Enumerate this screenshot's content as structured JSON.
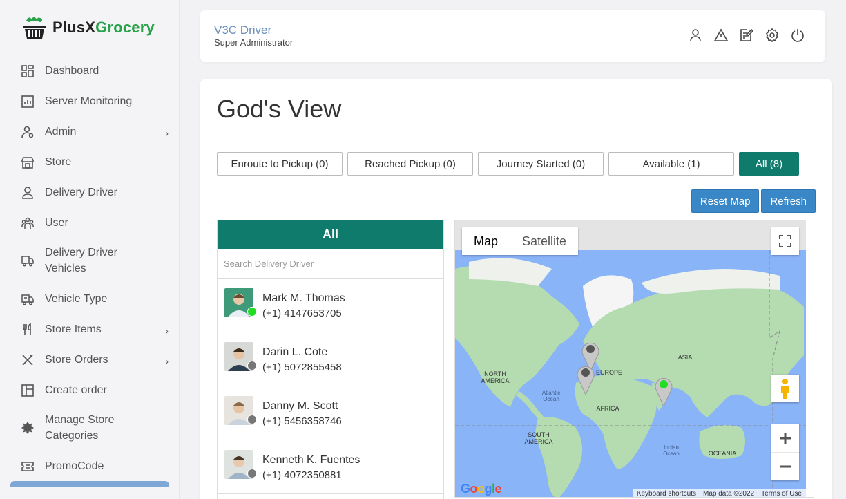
{
  "brand": {
    "name_part1": "PlusX",
    "name_part2": "Grocery"
  },
  "sidebar": {
    "items": [
      {
        "label": "Dashboard",
        "icon": "dashboard-icon"
      },
      {
        "label": "Server Monitoring",
        "icon": "chart-icon"
      },
      {
        "label": "Admin",
        "icon": "admin-user-icon",
        "has_submenu": true
      },
      {
        "label": "Store",
        "icon": "store-icon"
      },
      {
        "label": "Delivery Driver",
        "icon": "driver-icon"
      },
      {
        "label": "User",
        "icon": "users-icon"
      },
      {
        "label": "Delivery Driver Vehicles",
        "icon": "truck-icon"
      },
      {
        "label": "Vehicle Type",
        "icon": "vehicle-type-icon"
      },
      {
        "label": "Store Items",
        "icon": "fork-knife-icon",
        "has_submenu": true
      },
      {
        "label": "Store Orders",
        "icon": "utensils-cross-icon",
        "has_submenu": true
      },
      {
        "label": "Create order",
        "icon": "create-order-icon"
      },
      {
        "label": "Manage Store Categories",
        "icon": "gear-badge-icon"
      },
      {
        "label": "PromoCode",
        "icon": "promocode-icon"
      }
    ],
    "chevron": "›"
  },
  "header": {
    "user_name": "V3C Driver",
    "user_role": "Super Administrator",
    "icons": [
      "profile-icon",
      "alert-icon",
      "edit-note-icon",
      "settings-icon",
      "power-icon"
    ]
  },
  "page": {
    "title": "God's View"
  },
  "filters": [
    {
      "label": "Enroute to Pickup  (0)",
      "active": false
    },
    {
      "label": "Reached Pickup  (0)",
      "active": false
    },
    {
      "label": "Journey Started  (0)",
      "active": false
    },
    {
      "label": "Available  (1)",
      "active": false
    },
    {
      "label": "All  (8)",
      "active": true
    }
  ],
  "actions": {
    "reset_map": "Reset Map",
    "refresh": "Refresh"
  },
  "driver_panel": {
    "heading": "All",
    "search_placeholder": "Search Delivery Driver",
    "drivers": [
      {
        "name": "Mark M. Thomas",
        "phone": "(+1) 4147653705",
        "status": "online"
      },
      {
        "name": "Darin L. Cote",
        "phone": "(+1) 5072855458",
        "status": "offline"
      },
      {
        "name": "Danny M. Scott",
        "phone": "(+1) 5456358746",
        "status": "offline"
      },
      {
        "name": "Kenneth K. Fuentes",
        "phone": "(+1) 4072350881",
        "status": "offline"
      }
    ]
  },
  "map": {
    "type_options": [
      "Map",
      "Satellite"
    ],
    "selected_type": "Map",
    "labels": {
      "north_america": "NORTH\nAMERICA",
      "europe": "EUROPE",
      "asia": "ASIA",
      "africa": "AFRICA",
      "south_america": "SOUTH\nAMERICA",
      "oceania": "OCEANIA",
      "atlantic": "Atlantic\nOcean",
      "indian": "Indian\nOcean"
    },
    "footer": {
      "shortcuts": "Keyboard shortcuts",
      "data": "Map data ©2022",
      "terms": "Terms of Use"
    },
    "attribution": "Google",
    "colors": {
      "water": "#8ab4f8",
      "land": "#b5dbb0",
      "ice": "#f5f5f5",
      "online": "#22dd22",
      "offline": "#777777",
      "accent": "#0f7b6c",
      "button": "#3a87c8"
    }
  }
}
